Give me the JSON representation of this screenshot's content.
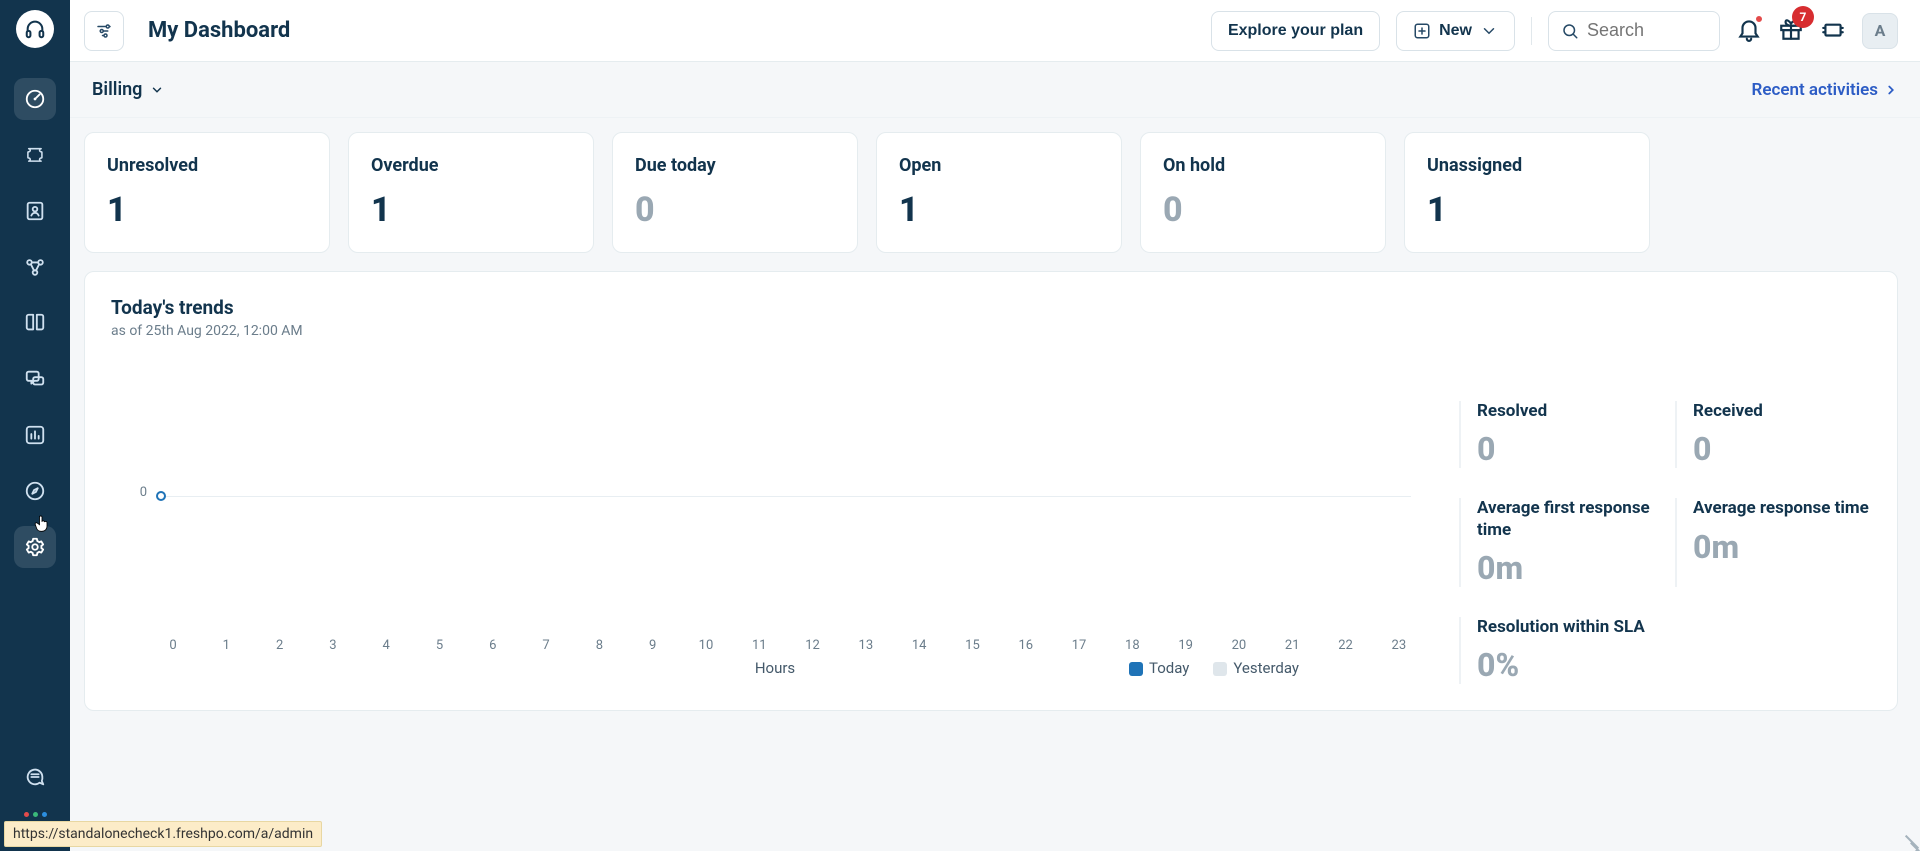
{
  "header": {
    "title": "My Dashboard",
    "explore": "Explore your plan",
    "new": "New",
    "search_placeholder": "Search",
    "gift_badge": "7",
    "avatar": "A"
  },
  "subheader": {
    "filter": "Billing",
    "recent": "Recent activities"
  },
  "stats": [
    {
      "label": "Unresolved",
      "value": "1",
      "muted": false
    },
    {
      "label": "Overdue",
      "value": "1",
      "muted": false
    },
    {
      "label": "Due today",
      "value": "0",
      "muted": true
    },
    {
      "label": "Open",
      "value": "1",
      "muted": false
    },
    {
      "label": "On hold",
      "value": "0",
      "muted": true
    },
    {
      "label": "Unassigned",
      "value": "1",
      "muted": false
    }
  ],
  "trends": {
    "title": "Today's trends",
    "asof": "as of 25th Aug 2022, 12:00 AM",
    "side": [
      {
        "label": "Resolved",
        "value": "0"
      },
      {
        "label": "Received",
        "value": "0"
      },
      {
        "label": "Average first response time",
        "value": "0m"
      },
      {
        "label": "Average response time",
        "value": "0m"
      },
      {
        "label": "Resolution within SLA",
        "value": "0%"
      }
    ],
    "y_tick": "0",
    "x_label": "Hours",
    "legend_today": "Today",
    "legend_yesterday": "Yesterday"
  },
  "chart_data": {
    "type": "line",
    "xlabel": "Hours",
    "ylabel": "",
    "x": [
      0,
      1,
      2,
      3,
      4,
      5,
      6,
      7,
      8,
      9,
      10,
      11,
      12,
      13,
      14,
      15,
      16,
      17,
      18,
      19,
      20,
      21,
      22,
      23
    ],
    "y_ticks": [
      0
    ],
    "series": [
      {
        "name": "Today",
        "color": "#1f73b7",
        "values": [
          0
        ]
      },
      {
        "name": "Yesterday",
        "color": "#dfe6eb",
        "values": []
      }
    ],
    "legend_position": "bottom-right",
    "ylim": [
      0,
      0
    ]
  },
  "url_tip": "https://standalonecheck1.freshpo.com/a/admin"
}
